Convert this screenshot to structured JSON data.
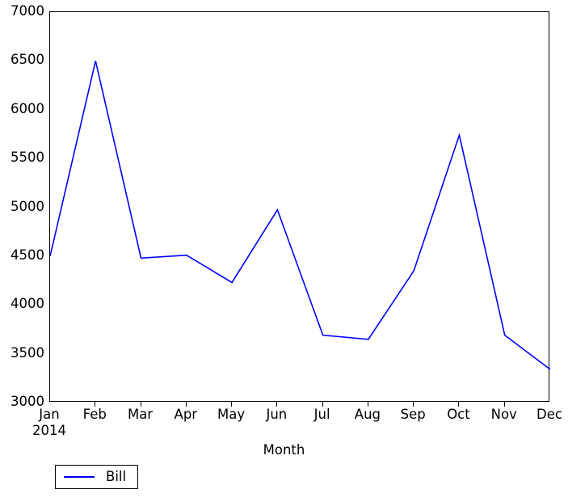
{
  "chart_data": {
    "type": "line",
    "title": "",
    "subtitle": "",
    "xlabel": "Month",
    "ylabel": "",
    "categories": [
      "Jan",
      "Feb",
      "Mar",
      "Apr",
      "May",
      "Jun",
      "Jul",
      "Aug",
      "Sep",
      "Oct",
      "Nov",
      "Dec"
    ],
    "x_secondary_label": "2014",
    "series": [
      {
        "name": "Bill",
        "color": "#0000ff",
        "values": [
          4500,
          6500,
          4480,
          4510,
          4230,
          4975,
          3690,
          3648,
          4350,
          5740,
          3690,
          3340
        ]
      }
    ],
    "ylim": [
      3000,
      7000
    ],
    "yticks": [
      3000,
      3500,
      4000,
      4500,
      5000,
      5500,
      6000,
      6500,
      7000
    ],
    "ytick_labels": [
      "3000",
      "3500",
      "4000",
      "4500",
      "5000",
      "5500",
      "6000",
      "6500",
      "7000"
    ],
    "grid": false,
    "legend": {
      "position": "below-left",
      "entries": [
        {
          "label": "Bill",
          "color": "#0000ff",
          "marker": "line"
        }
      ]
    },
    "frame": true,
    "background_color": "#ffffff",
    "axis_color": "#000000"
  }
}
